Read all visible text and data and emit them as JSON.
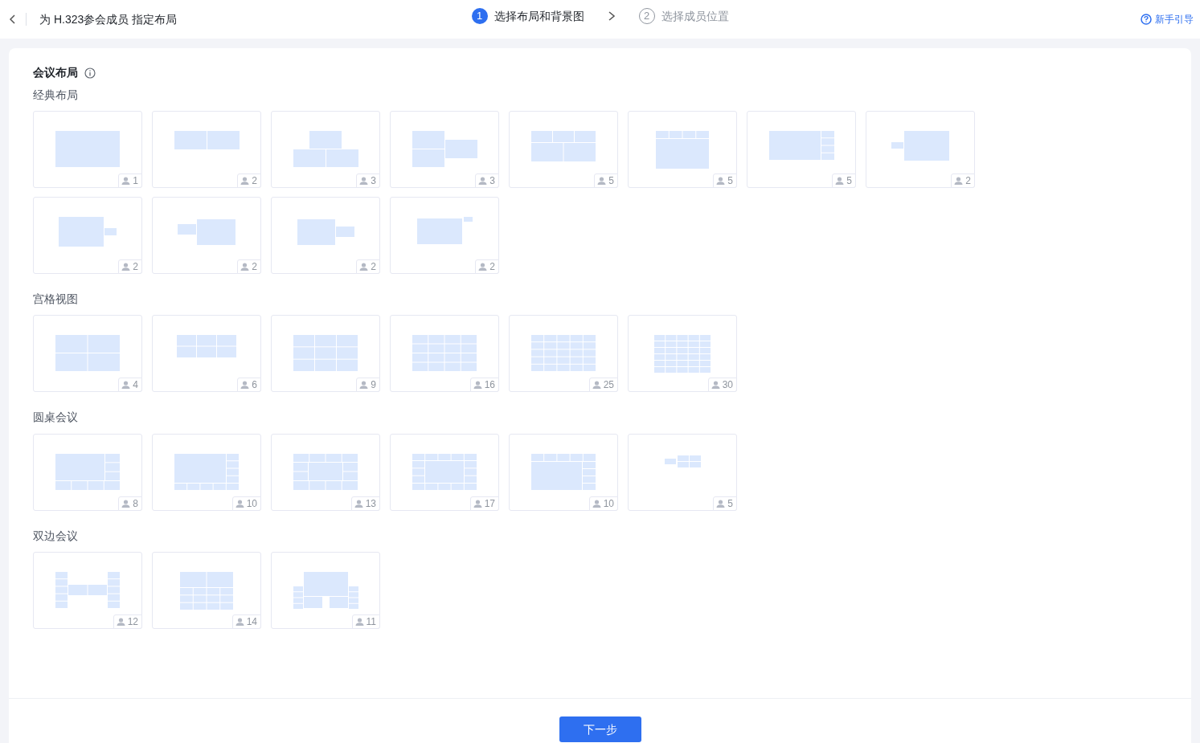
{
  "header": {
    "title": "为 H.323参会成员 指定布局",
    "help_link": "新手引导"
  },
  "steps": [
    {
      "number": "1",
      "label": "选择布局和背景图",
      "selected": true
    },
    {
      "number": "2",
      "label": "选择成员位置",
      "selected": false
    }
  ],
  "panel": {
    "title": "会议布局"
  },
  "sections": [
    {
      "title": "经典布局",
      "layouts": [
        {
          "kind": "single",
          "count": "1"
        },
        {
          "kind": "pair",
          "count": "2"
        },
        {
          "kind": "pyramid",
          "count": "3"
        },
        {
          "kind": "stack-side",
          "count": "3"
        },
        {
          "kind": "three-two",
          "count": "5"
        },
        {
          "kind": "strip-top",
          "count": "5"
        },
        {
          "kind": "strip-right",
          "count": "5"
        },
        {
          "kind": "pip-left",
          "count": "2"
        },
        {
          "kind": "pip-right",
          "count": "2"
        },
        {
          "kind": "side-left",
          "count": "2"
        },
        {
          "kind": "side-right",
          "count": "2"
        },
        {
          "kind": "corner",
          "count": "2"
        }
      ]
    },
    {
      "title": "宫格视图",
      "layouts": [
        {
          "kind": "grid-2x2",
          "count": "4"
        },
        {
          "kind": "grid-3x2",
          "count": "6"
        },
        {
          "kind": "grid-3x3",
          "count": "9"
        },
        {
          "kind": "grid-4x4",
          "count": "16"
        },
        {
          "kind": "grid-5x5",
          "count": "25"
        },
        {
          "kind": "grid-5x6",
          "count": "30"
        }
      ]
    },
    {
      "title": "圆桌会议",
      "layouts": [
        {
          "kind": "round-8",
          "count": "8"
        },
        {
          "kind": "round-10",
          "count": "10"
        },
        {
          "kind": "round-13",
          "count": "13"
        },
        {
          "kind": "round-17",
          "count": "17"
        },
        {
          "kind": "round-10b",
          "count": "10"
        },
        {
          "kind": "round-5",
          "count": "5"
        }
      ]
    },
    {
      "title": "双边会议",
      "layouts": [
        {
          "kind": "duo-12",
          "count": "12"
        },
        {
          "kind": "duo-14",
          "count": "14"
        },
        {
          "kind": "duo-11",
          "count": "11"
        }
      ]
    }
  ],
  "footer": {
    "next_button": "下一步"
  }
}
